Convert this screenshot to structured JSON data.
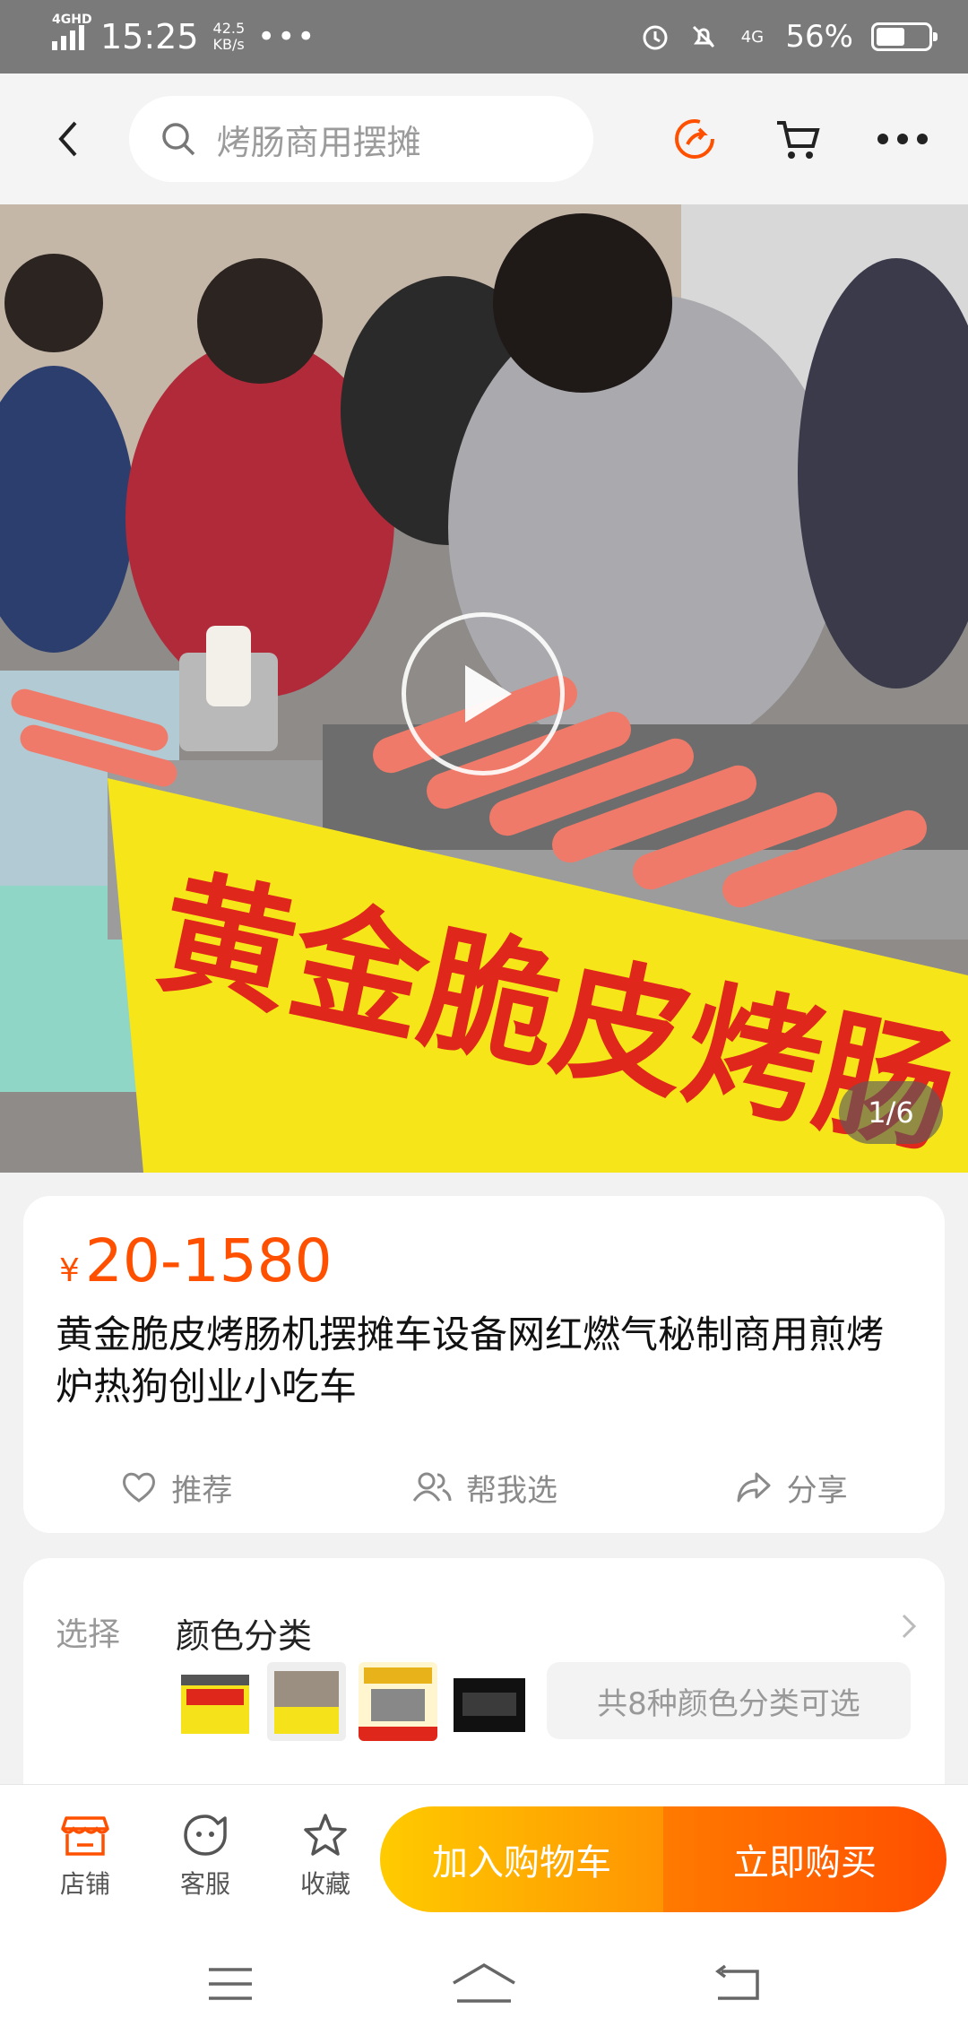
{
  "status_bar": {
    "network": "4GHD",
    "time": "15:25",
    "speed_value": "42.5",
    "speed_unit": "KB/s",
    "more": "•••",
    "alarm_icon": "alarm-icon",
    "mute_icon": "bell-off-icon",
    "data_label": "4G",
    "battery_percent": "56%",
    "battery_level": 0.56
  },
  "top_nav": {
    "search_placeholder": "烤肠商用摆摊",
    "icons": [
      "back-icon",
      "share-icon",
      "cart-icon",
      "more-icon"
    ],
    "accent_color": "#ff5000"
  },
  "hero": {
    "pager": "1/6",
    "banner_text": "黄金脆皮烤肠"
  },
  "product": {
    "currency": "¥",
    "price": "20-1580",
    "title": "黄金脆皮烤肠机摆摊车设备网红燃气秘制商用煎烤炉热狗创业小吃车",
    "actions": [
      {
        "label": "推荐",
        "icon": "heart-icon"
      },
      {
        "label": "帮我选",
        "icon": "people-icon"
      },
      {
        "label": "分享",
        "icon": "share-arrow-icon"
      }
    ]
  },
  "selection": {
    "label": "选择",
    "value": "颜色分类",
    "more_text": "共8种颜色分类可选"
  },
  "bottom_bar": {
    "tabs": [
      {
        "label": "店铺",
        "icon": "store-icon"
      },
      {
        "label": "客服",
        "icon": "service-icon"
      },
      {
        "label": "收藏",
        "icon": "star-icon"
      }
    ],
    "add_to_cart": "加入购物车",
    "buy_now": "立即购买"
  }
}
